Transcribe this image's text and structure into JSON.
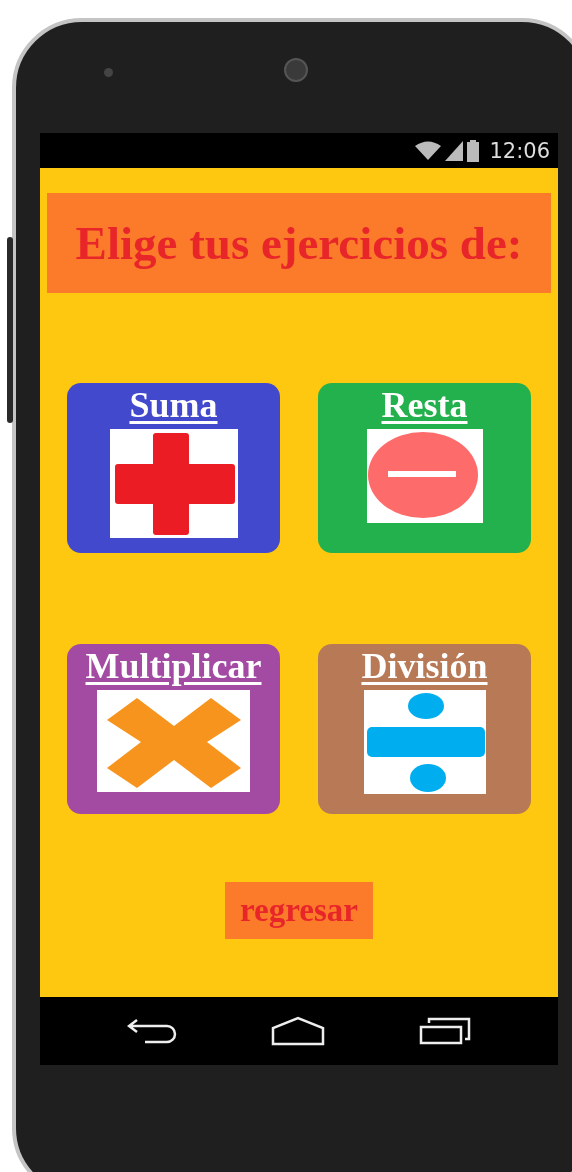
{
  "status_bar": {
    "time": "12:06"
  },
  "header": {
    "title": "Elige tus ejercicios de:"
  },
  "operations": [
    {
      "label": "Suma",
      "kind": "plus",
      "color": "#4249cc"
    },
    {
      "label": "Resta",
      "kind": "minus",
      "color": "#22b14c"
    },
    {
      "label": "Multiplicar",
      "kind": "times",
      "color": "#a34ba3"
    },
    {
      "label": "División",
      "kind": "divide",
      "color": "#b87a56"
    }
  ],
  "back_button": {
    "label": "regresar"
  }
}
